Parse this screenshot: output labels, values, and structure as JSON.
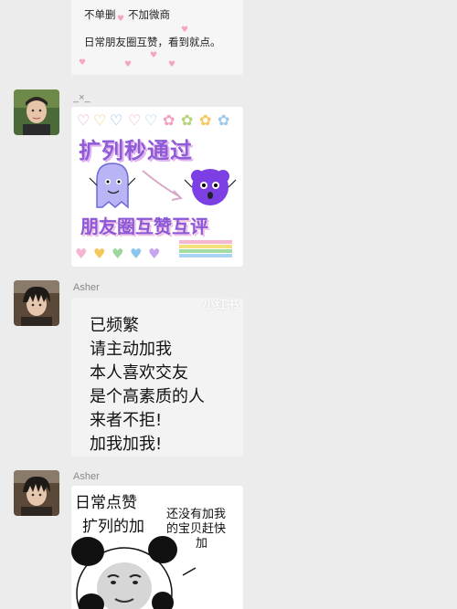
{
  "messages": [
    {
      "card_lines": [
        "不单删",
        "不加微商",
        "日常朋友圈互赞，看到就点。"
      ]
    },
    {
      "sender": "_×_",
      "sticker": {
        "title": "扩列秒通过",
        "subtitle": "朋友圈互赞互评"
      }
    },
    {
      "sender": "Asher",
      "text_lines": [
        "已频繁",
        "请主动加我",
        "本人喜欢交友",
        "是个高素质的人",
        "来者不拒!",
        "加我加我!"
      ],
      "watermark": "小红书"
    },
    {
      "sender": "Asher",
      "meme": {
        "line1": "日常点赞",
        "line2": "扩列的加",
        "side_text": [
          "还没有加我",
          "的宝贝赶快",
          "加"
        ]
      }
    }
  ],
  "colors": {
    "background": "#ececec",
    "sticker_purple": "#8f5bd6",
    "heart_pink": "#f3a6c1"
  }
}
